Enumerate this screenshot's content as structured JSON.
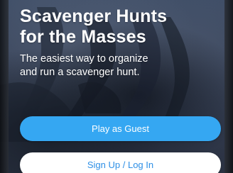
{
  "hero": {
    "title_line_1": "Scavenger Hunts",
    "title_line_2": "for the Masses",
    "subtitle_line_1": "The easiest way to organize",
    "subtitle_line_2": "and run a scavenger hunt."
  },
  "actions": {
    "primary_label": "Play as Guest",
    "secondary_label": "Sign Up / Log In"
  },
  "colors": {
    "primary": "#35a7f2",
    "secondary_bg": "#ffffff",
    "secondary_text": "#2d8fe6"
  }
}
